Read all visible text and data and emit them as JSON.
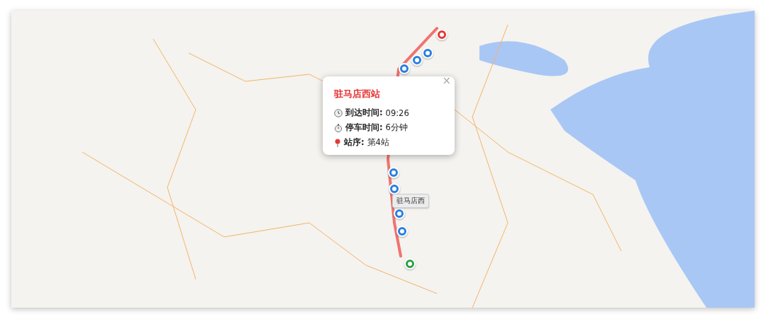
{
  "map": {
    "route": {
      "markers": [
        {
          "kind": "start"
        },
        {
          "kind": "stop"
        },
        {
          "kind": "stop"
        },
        {
          "kind": "stop"
        },
        {
          "kind": "stop"
        },
        {
          "kind": "stop"
        },
        {
          "kind": "stop"
        },
        {
          "kind": "stop"
        },
        {
          "kind": "end"
        }
      ]
    },
    "tooltip": {
      "text": "驻马店西"
    },
    "popup": {
      "title": "驻马店西站",
      "close": "×",
      "rows": [
        {
          "kind": "clock",
          "label": "到达时间:",
          "value": "09:26"
        },
        {
          "kind": "stopwatch",
          "label": "停车时间:",
          "value": "6分钟"
        },
        {
          "kind": "pin",
          "label": "站序:",
          "value": "第4站"
        }
      ]
    }
  }
}
